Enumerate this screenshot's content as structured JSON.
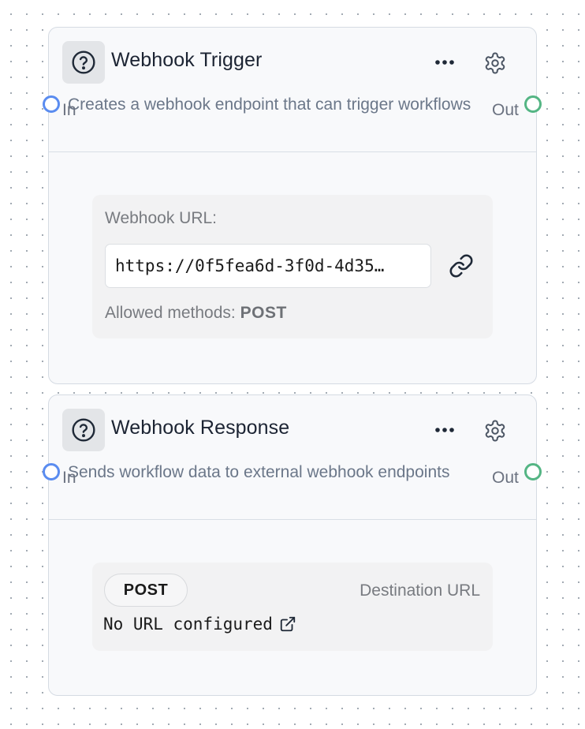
{
  "nodes": [
    {
      "title": "Webhook Trigger",
      "description": "Creates a webhook endpoint that can trigger workflows",
      "in_label": "In",
      "out_label": "Out",
      "url_label": "Webhook URL:",
      "url_value": "https://0f5fea6d-3f0d-4d35…",
      "allowed_methods_label": "Allowed methods:",
      "allowed_methods_value": "POST"
    },
    {
      "title": "Webhook Response",
      "description": "Sends workflow data to external webhook endpoints",
      "in_label": "In",
      "out_label": "Out",
      "method": "POST",
      "destination_label": "Destination URL",
      "destination_value": "No URL configured"
    }
  ],
  "colors": {
    "in_handle": "#5a8cf0",
    "out_handle": "#54b584",
    "canvas_dots": "#9aa3ad"
  },
  "icons": [
    "help-circle-icon",
    "more-horizontal-icon",
    "settings-gear-icon",
    "link-icon",
    "external-link-icon"
  ]
}
